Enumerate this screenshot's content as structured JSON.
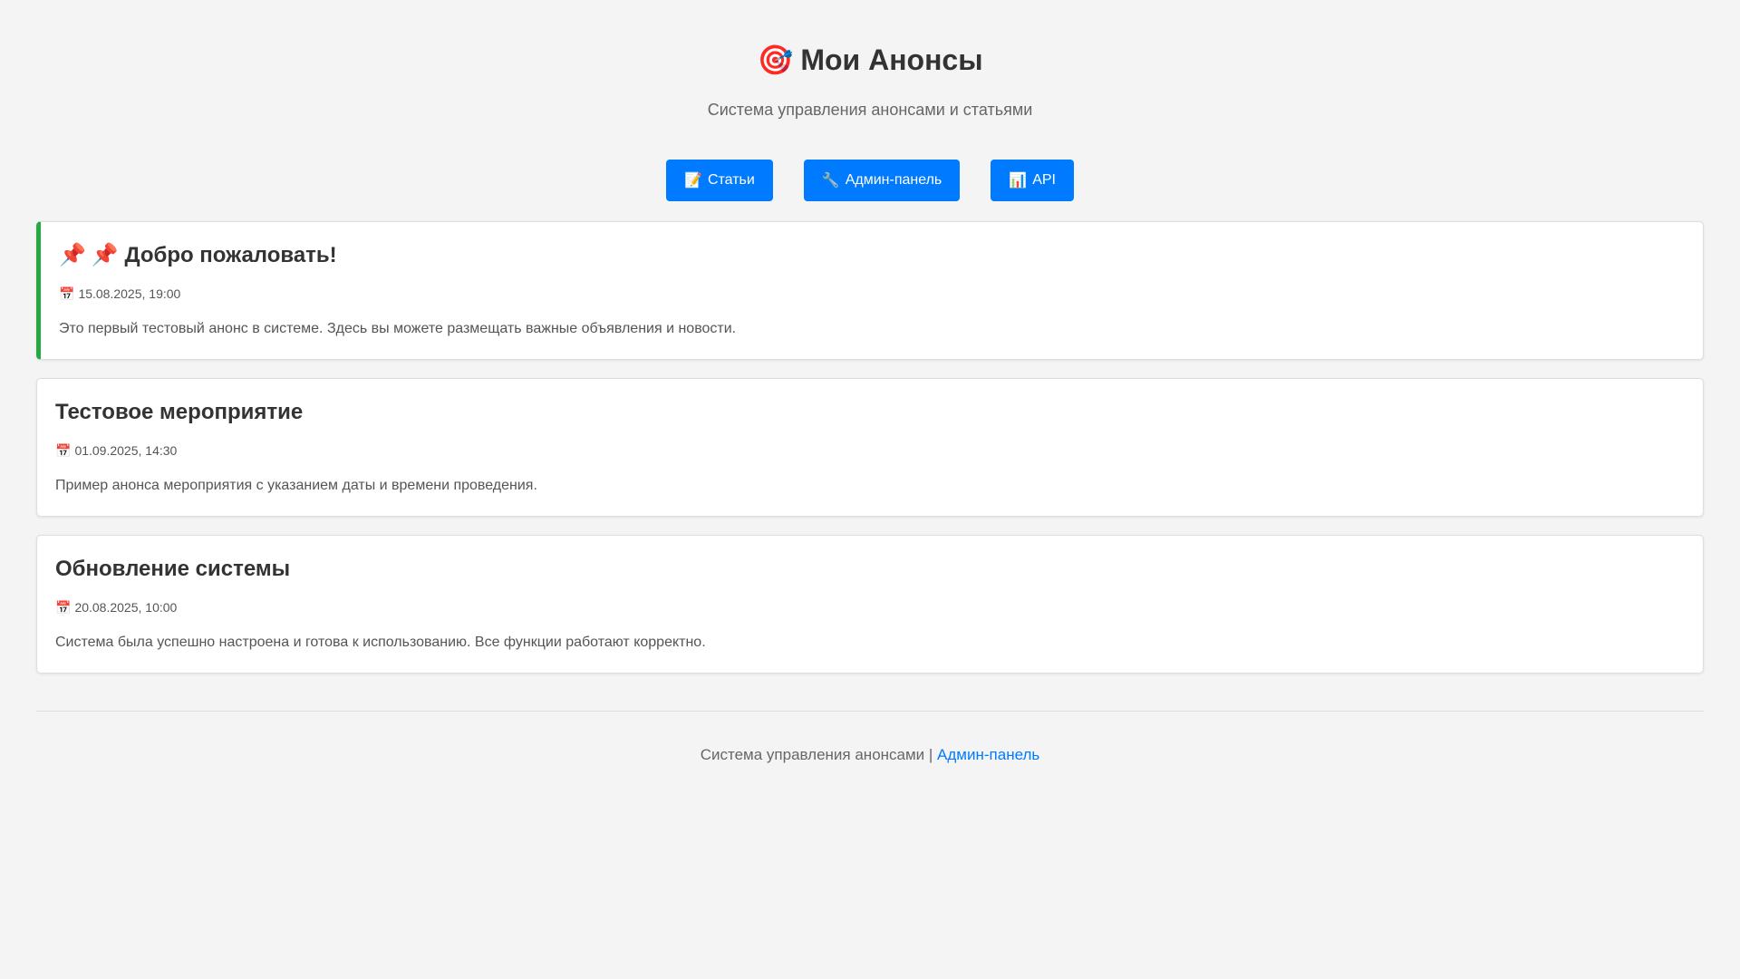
{
  "header": {
    "icon": "target-icon",
    "icon_glyph": "🎯",
    "title": "Мои Анонсы",
    "subtitle": "Система управления анонсами и статьями"
  },
  "nav": {
    "articles": {
      "icon_glyph": "📝",
      "label": "Статьи"
    },
    "admin": {
      "icon_glyph": "🔧",
      "label": "Админ-панель"
    },
    "api": {
      "icon_glyph": "📊",
      "label": "API"
    }
  },
  "announcements": [
    {
      "pinned": true,
      "pin_glyph": "📌",
      "title": "📌 Добро пожаловать!",
      "date_glyph": "📅",
      "date": "15.08.2025, 19:00",
      "text": "Это первый тестовый анонс в системе. Здесь вы можете размещать важные объявления и новости."
    },
    {
      "pinned": false,
      "title": "Тестовое мероприятие",
      "date_glyph": "📅",
      "date": "01.09.2025, 14:30",
      "text": "Пример анонса мероприятия с указанием даты и времени проведения."
    },
    {
      "pinned": false,
      "title": "Обновление системы",
      "date_glyph": "📅",
      "date": "20.08.2025, 10:00",
      "text": "Система была успешно настроена и готова к использованию. Все функции работают корректно."
    }
  ],
  "footer": {
    "text": "Система управления анонсами | ",
    "link_label": "Админ-панель"
  },
  "colors": {
    "background": "#f4f4f4",
    "accent": "#007bff",
    "pinned_border": "#28a745"
  }
}
